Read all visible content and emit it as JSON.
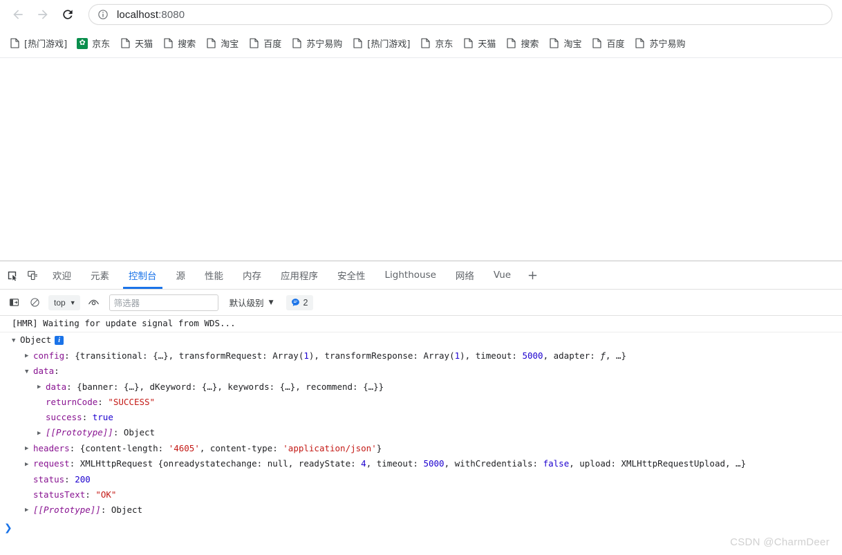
{
  "browser": {
    "back_label": "Back",
    "forward_label": "Forward",
    "reload_label": "Reload",
    "site_info_label": "View site information",
    "url_host": "localhost",
    "url_port": ":8080",
    "url_full": "localhost:8080"
  },
  "bookmarks": [
    {
      "label": "[热门游戏]",
      "icon": "page-icon"
    },
    {
      "label": "京东",
      "icon": "jd-icon"
    },
    {
      "label": "天猫",
      "icon": "page-icon"
    },
    {
      "label": "搜索",
      "icon": "page-icon"
    },
    {
      "label": "淘宝",
      "icon": "page-icon"
    },
    {
      "label": "百度",
      "icon": "page-icon"
    },
    {
      "label": "苏宁易购",
      "icon": "page-icon"
    },
    {
      "label": "[热门游戏]",
      "icon": "page-icon"
    },
    {
      "label": "京东",
      "icon": "page-icon"
    },
    {
      "label": "天猫",
      "icon": "page-icon"
    },
    {
      "label": "搜索",
      "icon": "page-icon"
    },
    {
      "label": "淘宝",
      "icon": "page-icon"
    },
    {
      "label": "百度",
      "icon": "page-icon"
    },
    {
      "label": "苏宁易购",
      "icon": "page-icon"
    }
  ],
  "devtools": {
    "inspect_label": "检查元素",
    "device_toolbar_label": "切换设备工具栏",
    "tabs": [
      {
        "label": "欢迎",
        "active": false
      },
      {
        "label": "元素",
        "active": false
      },
      {
        "label": "控制台",
        "active": true
      },
      {
        "label": "源",
        "active": false
      },
      {
        "label": "性能",
        "active": false
      },
      {
        "label": "内存",
        "active": false
      },
      {
        "label": "应用程序",
        "active": false
      },
      {
        "label": "安全性",
        "active": false
      },
      {
        "label": "Lighthouse",
        "active": false
      },
      {
        "label": "网络",
        "active": false
      },
      {
        "label": "Vue",
        "active": false
      }
    ],
    "add_tab_label": "+"
  },
  "console_toolbar": {
    "sidebar_toggle_label": "显示控制台侧边栏",
    "clear_label": "清除控制台",
    "context_value": "top",
    "eye_label": "创建实时表达式",
    "filter_placeholder": "筛选器",
    "filter_value": "",
    "level_value": "默认级别",
    "message_count": "2",
    "caret": "▼"
  },
  "console_log": {
    "hmr_message": "[HMR] Waiting for update signal from WDS...",
    "object_label": "Object",
    "rows": [
      {
        "indent": 1,
        "triangle": "closed",
        "key": "config",
        "value": "{transitional: {…}, transformRequest: Array(1), transformResponse: Array(1), timeout: 5000, adapter: ƒ, …}"
      },
      {
        "indent": 1,
        "triangle": "open",
        "key": "data",
        "value": ""
      },
      {
        "indent": 2,
        "triangle": "closed",
        "key": "data",
        "value": "{banner: {…}, dKeyword: {…}, keywords: {…}, recommend: {…}}"
      },
      {
        "indent": 2,
        "triangle": "none",
        "key": "returnCode",
        "value": "\"SUCCESS\""
      },
      {
        "indent": 2,
        "triangle": "none",
        "key": "success",
        "value": "true"
      },
      {
        "indent": 2,
        "triangle": "closed",
        "key": "[[Prototype]]",
        "value": "Object"
      },
      {
        "indent": 1,
        "triangle": "closed",
        "key": "headers",
        "value": "{content-length: '4605', content-type: 'application/json'}"
      },
      {
        "indent": 1,
        "triangle": "closed",
        "key": "request",
        "value": "XMLHttpRequest {onreadystatechange: null, readyState: 4, timeout: 5000, withCredentials: false, upload: XMLHttpRequestUpload, …}"
      },
      {
        "indent": 1,
        "triangle": "none",
        "key": "status",
        "value": "200"
      },
      {
        "indent": 1,
        "triangle": "none",
        "key": "statusText",
        "value": "\"OK\""
      },
      {
        "indent": 1,
        "triangle": "closed",
        "key": "[[Prototype]]",
        "value": "Object"
      }
    ],
    "prompt_chevron": "❯"
  },
  "watermark": "CSDN @CharmDeer",
  "colors": {
    "accent": "#1a73e8",
    "property": "#881391",
    "string": "#c41a16",
    "number": "#1c00cf",
    "jd_green": "#0a8f4d"
  }
}
